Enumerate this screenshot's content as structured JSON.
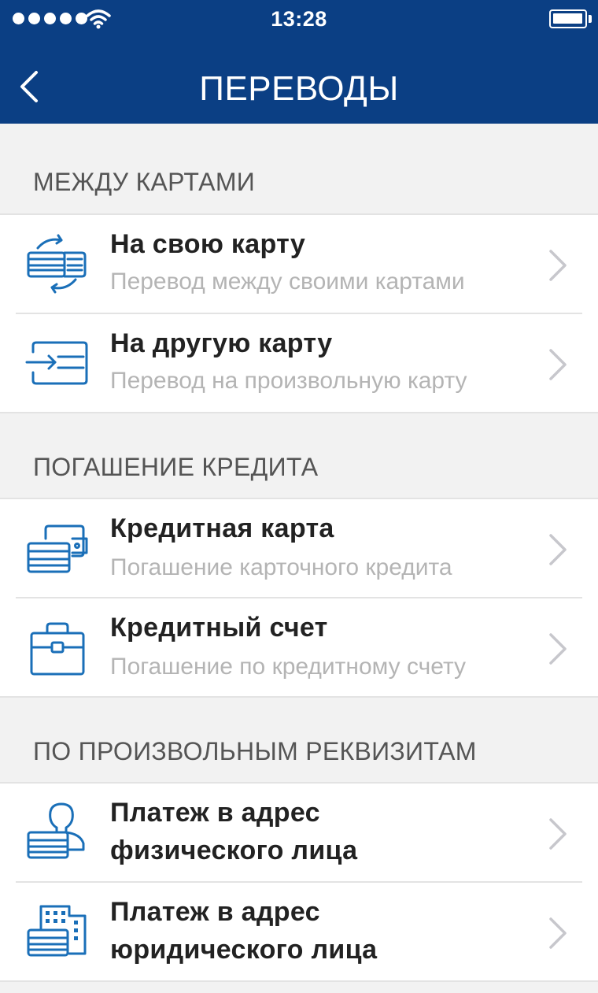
{
  "status_bar": {
    "time": "13:28"
  },
  "nav": {
    "title": "ПЕРЕВОДЫ"
  },
  "sections": [
    {
      "header": "МЕЖДУ КАРТАМИ",
      "items": [
        {
          "title": "На свою карту",
          "subtitle": "Перевод между своими картами",
          "icon": "cards-exchange-icon"
        },
        {
          "title": "На другую карту",
          "subtitle": "Перевод на произвольную карту",
          "icon": "card-transfer-icon"
        }
      ]
    },
    {
      "header": "ПОГАШЕНИЕ КРЕДИТА",
      "items": [
        {
          "title": "Кредитная карта",
          "subtitle": "Погашение карточного кредита",
          "icon": "card-wallet-icon"
        },
        {
          "title": "Кредитный счет",
          "subtitle": "Погашение по кредитному счету",
          "icon": "briefcase-icon"
        }
      ]
    },
    {
      "header": "ПО ПРОИЗВОЛЬНЫМ РЕКВИЗИТАМ",
      "items": [
        {
          "title_line1": "Платеж в адрес",
          "title_line2": "физического лица",
          "icon": "person-card-icon"
        },
        {
          "title_line1": "Платеж в адрес",
          "title_line2": "юридического лица",
          "icon": "building-card-icon"
        }
      ]
    }
  ],
  "colors": {
    "header_bg": "#0b3f84",
    "icon_blue": "#1a6fb8",
    "subtitle_gray": "#b4b4b4",
    "background": "#f2f2f2"
  }
}
